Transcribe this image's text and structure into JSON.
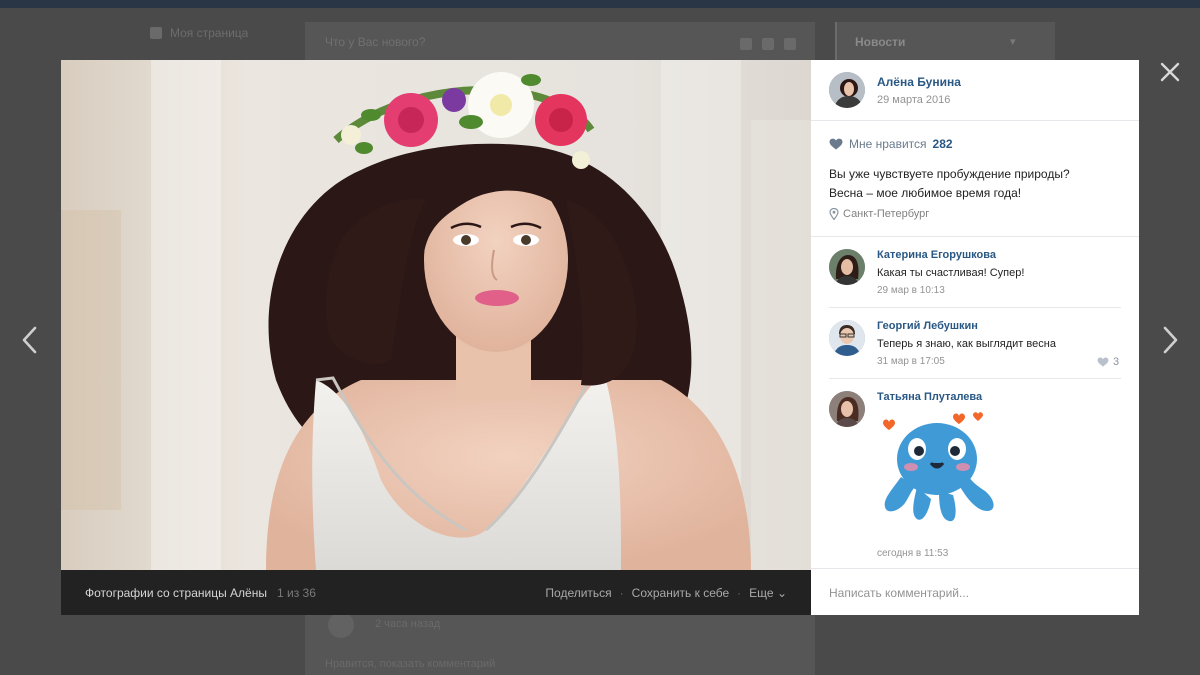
{
  "background": {
    "left_nav_label": "Моя страница",
    "feed_placeholder": "Что у Вас нового?",
    "right_title": "Новости",
    "under_text_1": "2 часа назад",
    "under_text_2": "Нравится, показать комментарий"
  },
  "viewer": {
    "close_icon": "close-icon",
    "prev_icon": "chevron-left-icon",
    "next_icon": "chevron-right-icon",
    "footer": {
      "album_title": "Фотографии со страницы Алёны",
      "counter": "1 из 36",
      "share_label": "Поделиться",
      "save_label": "Сохранить к себе",
      "more_label": "Еще"
    },
    "author": {
      "name": "Алёна Бунина",
      "date": "29 марта 2016"
    },
    "likes": {
      "label": "Мне нравится",
      "count": "282"
    },
    "description": {
      "line1": "Вы уже чувствуете пробуждение природы?",
      "line2": "Весна – мое любимое время года!"
    },
    "place": "Санкт-Петербург",
    "comments": [
      {
        "name": "Катерина Егорушкова",
        "text": "Какая ты счастливая! Супер!",
        "date": "29 мар в 10:13"
      },
      {
        "name": "Георгий Лебушкин",
        "text": "Теперь я знаю, как выглядит весна",
        "date": "31 мар в 17:05",
        "likes": "3"
      },
      {
        "name": "Татьяна Плуталева",
        "date": "сегодня в 11:53"
      }
    ],
    "comment_placeholder": "Написать комментарий..."
  },
  "colors": {
    "accent": "#2a5885",
    "overlay": "#3c3c3c",
    "footer_bg": "#222222",
    "sticker_blue": "#3f9ad6",
    "heart_orange": "#f2682a"
  }
}
